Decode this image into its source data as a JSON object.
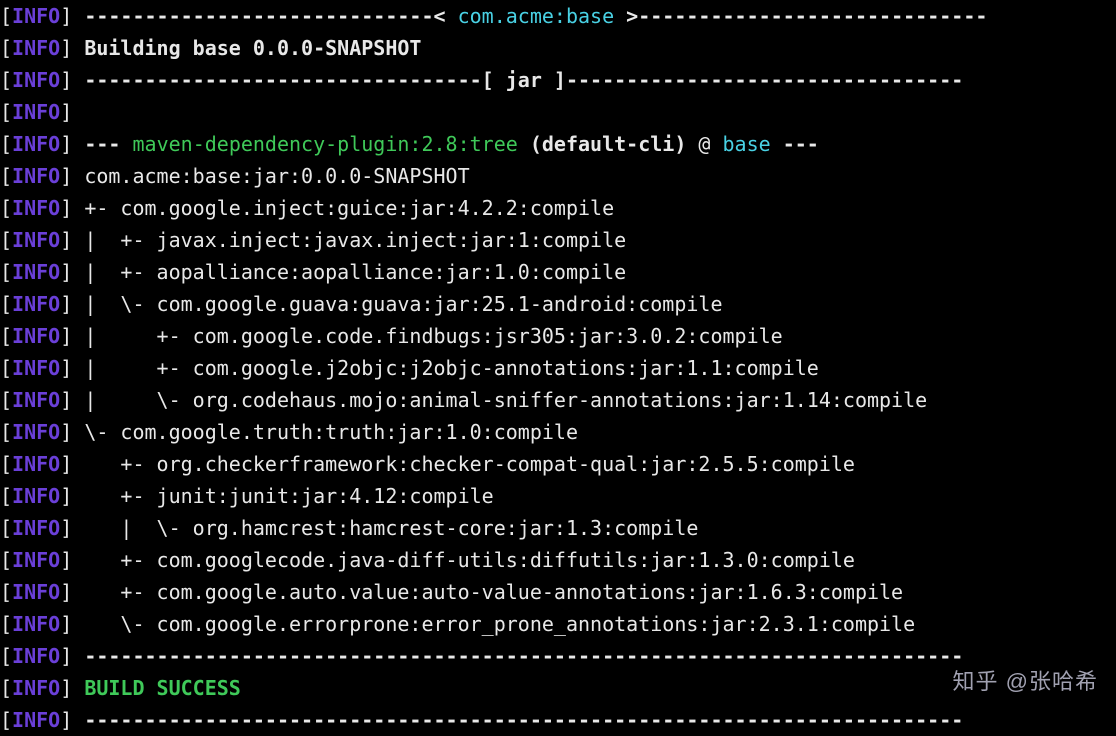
{
  "label": "INFO",
  "header": {
    "prefix": "-----------------------------< ",
    "artifact": "com.acme:base",
    "suffix": " >-----------------------------"
  },
  "building": "Building base 0.0.0-SNAPSHOT",
  "jar_line": "---------------------------------[ jar ]---------------------------------",
  "plugin": {
    "dash": "--- ",
    "name": "maven-dependency-plugin:2.8:tree",
    "goal": " (default-cli) ",
    "at": "@ ",
    "module": "base",
    "tail": " ---"
  },
  "tree": [
    "com.acme:base:jar:0.0.0-SNAPSHOT",
    "+- com.google.inject:guice:jar:4.2.2:compile",
    "|  +- javax.inject:javax.inject:jar:1:compile",
    "|  +- aopalliance:aopalliance:jar:1.0:compile",
    "|  \\- com.google.guava:guava:jar:25.1-android:compile",
    "|     +- com.google.code.findbugs:jsr305:jar:3.0.2:compile",
    "|     +- com.google.j2objc:j2objc-annotations:jar:1.1:compile",
    "|     \\- org.codehaus.mojo:animal-sniffer-annotations:jar:1.14:compile",
    "\\- com.google.truth:truth:jar:1.0:compile",
    "   +- org.checkerframework:checker-compat-qual:jar:2.5.5:compile",
    "   +- junit:junit:jar:4.12:compile",
    "   |  \\- org.hamcrest:hamcrest-core:jar:1.3:compile",
    "   +- com.googlecode.java-diff-utils:diffutils:jar:1.3.0:compile",
    "   +- com.google.auto.value:auto-value-annotations:jar:1.6.3:compile",
    "   \\- com.google.errorprone:error_prone_annotations:jar:2.3.1:compile"
  ],
  "rule": "-------------------------------------------------------------------------",
  "success": "BUILD SUCCESS",
  "watermark": "知乎 @张哈希",
  "colors": {
    "info_label": "#6a3fd8",
    "cyan": "#49d1e4",
    "green": "#3fc959",
    "text": "#e8e8e8",
    "bg": "#000000"
  }
}
